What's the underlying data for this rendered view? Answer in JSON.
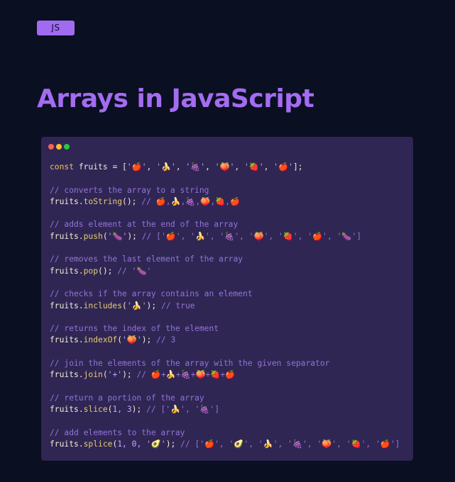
{
  "badge": "JS",
  "title": "Arrays in JavaScript",
  "window": {
    "dots": [
      "red",
      "yellow",
      "green"
    ]
  },
  "code": {
    "declaration": {
      "keyword": "const",
      "variable": "fruits",
      "assign": " = [",
      "items": [
        "'🍎'",
        "'🍌'",
        "'🍇'",
        "'🍑'",
        "'🍓'",
        "'🍎'"
      ],
      "end": "];"
    },
    "blocks": [
      {
        "comment": "// converts the array to a string",
        "obj": "fruits",
        "method": "toString",
        "args": "",
        "result": "// 🍎,🍌,🍇,🍑,🍓,🍎"
      },
      {
        "comment": "// adds element at the end of the array",
        "obj": "fruits",
        "method": "push",
        "args": "'🍆'",
        "result": "// ['🍎', '🍌', '🍇', '🍑', '🍓', '🍎', '🍆']"
      },
      {
        "comment": "// removes the last element of the array",
        "obj": "fruits",
        "method": "pop",
        "args": "",
        "result": "// '🍆'"
      },
      {
        "comment": "// checks if the array contains an element",
        "obj": "fruits",
        "method": "includes",
        "args": "'🍌'",
        "result": "// true"
      },
      {
        "comment": "// returns the index of the element",
        "obj": "fruits",
        "method": "indexOf",
        "args": "'🍑'",
        "result": "// 3"
      },
      {
        "comment": "// join the elements of the array with the given separator",
        "obj": "fruits",
        "method": "join",
        "args": "'+'",
        "result": "// 🍎+🍌+🍇+🍑+🍓+🍎"
      },
      {
        "comment": "// return a portion of the array",
        "obj": "fruits",
        "method": "slice",
        "args": "1, 3",
        "result": "// ['🍌', '🍇']"
      },
      {
        "comment": "// add elements to the array",
        "obj": "fruits",
        "method": "splice",
        "args": "1, 0, '🥑'",
        "result": "// ['🍎', '🥑', '🍌', '🍇', '🍑', '🍓', '🍎']"
      }
    ]
  }
}
